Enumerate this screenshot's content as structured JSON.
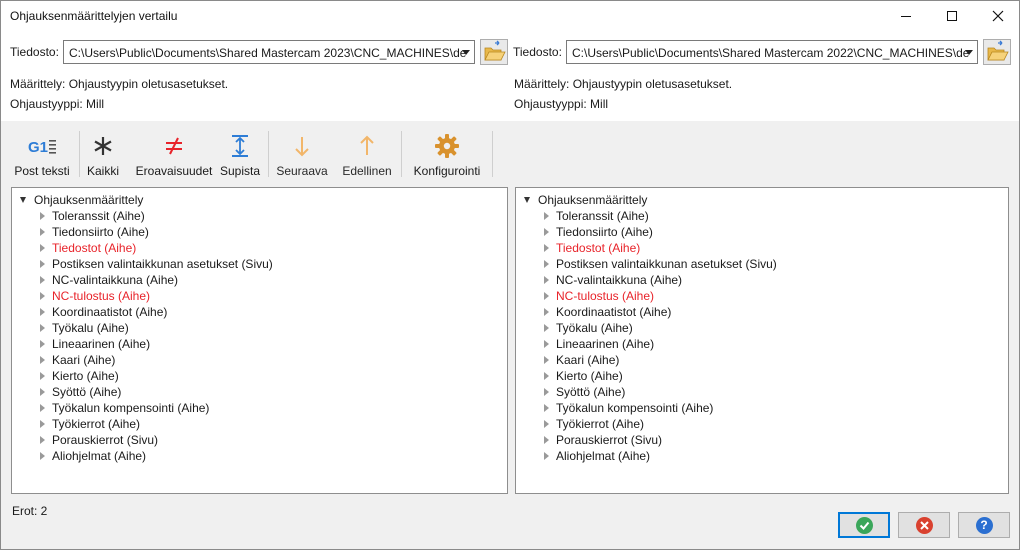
{
  "window": {
    "title": "Ohjauksenmäärittelyjen vertailu"
  },
  "left": {
    "file_label": "Tiedosto:",
    "file_path": "C:\\Users\\Public\\Documents\\Shared Mastercam 2023\\CNC_MACHINES\\de",
    "definition_label": "Määrittely:",
    "definition_value": "Ohjaustyypin oletusasetukset.",
    "control_type_label": "Ohjaustyyppi:",
    "control_type_value": "Mill"
  },
  "right": {
    "file_label": "Tiedosto:",
    "file_path": "C:\\Users\\Public\\Documents\\Shared Mastercam 2022\\CNC_MACHINES\\de",
    "definition_label": "Määrittely:",
    "definition_value": "Ohjaustyypin oletusasetukset.",
    "control_type_label": "Ohjaustyyppi:",
    "control_type_value": "Mill"
  },
  "toolbar": {
    "post_text": "Post teksti",
    "all": "Kaikki",
    "differences": "Eroavaisuudet",
    "collapse": "Supista",
    "next": "Seuraava",
    "previous": "Edellinen",
    "configuration": "Konfigurointi"
  },
  "tree": {
    "root": "Ohjauksenmäärittely",
    "items": [
      {
        "label": "Toleranssit (Aihe)",
        "diff": false
      },
      {
        "label": "Tiedonsiirto (Aihe)",
        "diff": false
      },
      {
        "label": "Tiedostot (Aihe)",
        "diff": true
      },
      {
        "label": "Postiksen valintaikkunan asetukset (Sivu)",
        "diff": false
      },
      {
        "label": "NC-valintaikkuna (Aihe)",
        "diff": false
      },
      {
        "label": "NC-tulostus (Aihe)",
        "diff": true
      },
      {
        "label": "Koordinaatistot (Aihe)",
        "diff": false
      },
      {
        "label": "Työkalu (Aihe)",
        "diff": false
      },
      {
        "label": "Lineaarinen (Aihe)",
        "diff": false
      },
      {
        "label": "Kaari (Aihe)",
        "diff": false
      },
      {
        "label": "Kierto (Aihe)",
        "diff": false
      },
      {
        "label": "Syöttö (Aihe)",
        "diff": false
      },
      {
        "label": "Työkalun kompensointi (Aihe)",
        "diff": false
      },
      {
        "label": "Työkierrot (Aihe)",
        "diff": false
      },
      {
        "label": "Porauskierrot (Sivu)",
        "diff": false
      },
      {
        "label": "Aliohjelmat (Aihe)",
        "diff": false
      }
    ]
  },
  "status": {
    "differences_count": "Erot: 2"
  },
  "colors": {
    "diff_text": "#e8232a",
    "ok": "#3aa65a",
    "cancel": "#d9412f",
    "help": "#2b6fd1",
    "accent": "#0078d7"
  }
}
